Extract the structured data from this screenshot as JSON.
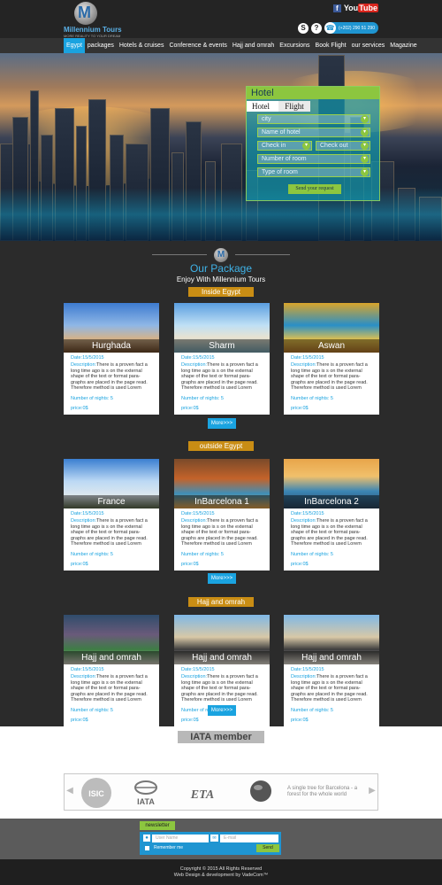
{
  "brand": {
    "name": "Millennium Tours",
    "tagline": "MORE REALITY TO YOUR DREAM"
  },
  "header": {
    "youtube_label": "You",
    "youtube_tube": "Tube",
    "phone": "(+202) 290 51 290",
    "icons": [
      "facebook-icon",
      "youtube-icon",
      "skype-icon",
      "help-icon",
      "phone-icon"
    ]
  },
  "nav": {
    "items": [
      "Egypt",
      "packages",
      "Hotels & cruises",
      "Conference & events",
      "Hajj and omrah",
      "Excursions",
      "Book Flight",
      "our services",
      "Magazine"
    ],
    "active_index": 0
  },
  "search": {
    "title": "Hotel",
    "tabs": [
      "Hotel",
      "Flight"
    ],
    "city_placeholder": "city",
    "hotel_placeholder": "Name of hotel",
    "checkin_placeholder": "Check in",
    "checkout_placeholder": "Check out",
    "nights_placeholder": "Number of room",
    "roomtype_placeholder": "Type of room",
    "submit_label": "Send your request"
  },
  "packages": {
    "title": "Our Package",
    "subtitle": "Enjoy With Millennium Tours",
    "more_label": "More>>>",
    "sections": [
      {
        "label": "Inside  Egypt",
        "cards": [
          {
            "title": "Hurghada",
            "date": "Date:15/5/2015",
            "desc_key": "Description:",
            "desc": "There is a proven fact a long time ago is s on the external shape of the text or format para-graphs are placed in the page read. Therefore method is used Lorem",
            "nights": "Number of nights: 5",
            "price": "price:0$"
          },
          {
            "title": "Sharm",
            "date": "Date:15/5/2015",
            "desc_key": "Description:",
            "desc": "There is a proven fact a long time ago is s on the external shape of the text or format para-graphs are placed in the page read. Therefore method is used Lorem",
            "nights": "Number of nights: 5",
            "price": "price:0$"
          },
          {
            "title": "Aswan",
            "date": "Date:15/5/2015",
            "desc_key": "Description:",
            "desc": "There is a proven fact a long time ago is s on the external shape of the text or format para-graphs are placed in the page read. Therefore method is used Lorem",
            "nights": "Number of nights: 5",
            "price": "price:0$"
          }
        ]
      },
      {
        "label": "outside  Egypt",
        "cards": [
          {
            "title": "France",
            "date": "Date:15/5/2015",
            "desc_key": "Description:",
            "desc": "There is a proven fact a long time ago is s on the external shape of the text or format para-graphs are placed in the page read. Therefore method is used Lorem",
            "nights": "Number of nights: 5",
            "price": "price:0$"
          },
          {
            "title": "InBarcelona 1",
            "date": "Date:15/5/2015",
            "desc_key": "Description:",
            "desc": "There is a proven fact a long time ago is s on the external shape of the text or format para-graphs are placed in the page read. Therefore method is used Lorem",
            "nights": "Number of nights: 5",
            "price": "price:0$"
          },
          {
            "title": "InBarcelona 2",
            "date": "Date:15/5/2015",
            "desc_key": "Description:",
            "desc": "There is a proven fact a long time ago is s on the external shape of the text or format para-graphs are placed in the page read. Therefore method is used Lorem",
            "nights": "Number of nights: 5",
            "price": "price:0$"
          }
        ]
      },
      {
        "label": "Hajj and omrah",
        "cards": [
          {
            "title": "Hajj and omrah",
            "date": "Date:15/5/2015",
            "desc_key": "Description:",
            "desc": "There is a proven fact a long time ago is s on the external shape of the text or format para-graphs are placed in the page read. Therefore method is used Lorem",
            "nights": "Number of nights: 5",
            "price": "price:0$"
          },
          {
            "title": "Hajj and omrah",
            "date": "Date:15/5/2015",
            "desc_key": "Description:",
            "desc": "There is a proven fact a long time ago is s on the external shape of the text or format para-graphs are placed in the page read. Therefore method is used Lorem",
            "nights": "Number of nights: 5",
            "price": "price:0$"
          },
          {
            "title": "Hajj and omrah",
            "date": "Date:15/5/2015",
            "desc_key": "Description:",
            "desc": "There is a proven fact a long time ago is s on the external shape of the text or format para-graphs are placed in the page read. Therefore method is used Lorem",
            "nights": "Number of nights: 5",
            "price": "price:0$"
          }
        ]
      }
    ]
  },
  "iata": {
    "title": "IATA member",
    "partners": [
      "ISIC",
      "IATA",
      "ETA",
      "globe",
      "A single tree for Barcelona - a forest for the whole world"
    ]
  },
  "newsletter": {
    "label": "newsletter",
    "name_placeholder": "User Name",
    "email_placeholder": "E-mail",
    "remember_label": "Remember me",
    "send_label": "Send"
  },
  "footer": {
    "copyright": "Copyright © 2015 All Rights Reserved",
    "credit": "Web Design & development by VadeCom™"
  },
  "colors": {
    "accent": "#1aa3e0",
    "green": "#8cc63f",
    "badge": "#c98d14",
    "bg": "#2b2b2b"
  }
}
